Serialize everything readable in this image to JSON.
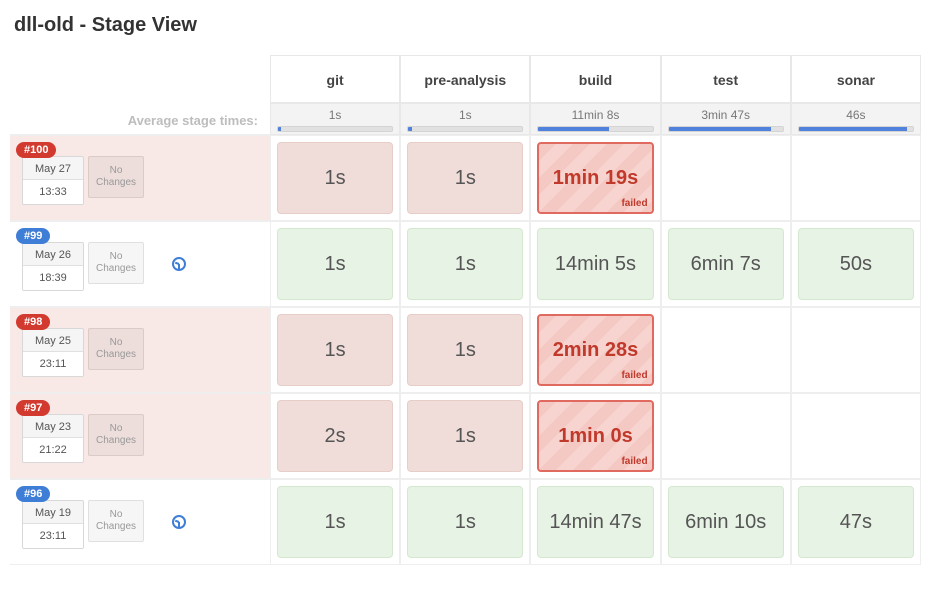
{
  "title": "dll-old - Stage View",
  "avg_label": "Average stage times:",
  "no_changes_text": "No\nChanges",
  "failed_text": "failed",
  "stages": [
    {
      "name": "git",
      "avg": "1s",
      "bar_pct": 3
    },
    {
      "name": "pre-analysis",
      "avg": "1s",
      "bar_pct": 3
    },
    {
      "name": "build",
      "avg": "11min 8s",
      "bar_pct": 62
    },
    {
      "name": "test",
      "avg": "3min 47s",
      "bar_pct": 90
    },
    {
      "name": "sonar",
      "avg": "46s",
      "bar_pct": 95
    }
  ],
  "runs": [
    {
      "id": "#100",
      "date": "May 27",
      "time": "13:33",
      "status": "failed",
      "has_clock": false,
      "cells": [
        {
          "text": "1s",
          "state": "fail-row"
        },
        {
          "text": "1s",
          "state": "fail-row"
        },
        {
          "text": "1min 19s",
          "state": "failed"
        },
        {
          "text": "",
          "state": "empty"
        },
        {
          "text": "",
          "state": "empty"
        }
      ]
    },
    {
      "id": "#99",
      "date": "May 26",
      "time": "18:39",
      "status": "success",
      "has_clock": true,
      "cells": [
        {
          "text": "1s",
          "state": "success"
        },
        {
          "text": "1s",
          "state": "success"
        },
        {
          "text": "14min 5s",
          "state": "success"
        },
        {
          "text": "6min 7s",
          "state": "success"
        },
        {
          "text": "50s",
          "state": "success"
        }
      ]
    },
    {
      "id": "#98",
      "date": "May 25",
      "time": "23:11",
      "status": "failed",
      "has_clock": false,
      "cells": [
        {
          "text": "1s",
          "state": "fail-row"
        },
        {
          "text": "1s",
          "state": "fail-row"
        },
        {
          "text": "2min 28s",
          "state": "failed"
        },
        {
          "text": "",
          "state": "empty"
        },
        {
          "text": "",
          "state": "empty"
        }
      ]
    },
    {
      "id": "#97",
      "date": "May 23",
      "time": "21:22",
      "status": "failed",
      "has_clock": false,
      "cells": [
        {
          "text": "2s",
          "state": "fail-row"
        },
        {
          "text": "1s",
          "state": "fail-row"
        },
        {
          "text": "1min 0s",
          "state": "failed"
        },
        {
          "text": "",
          "state": "empty"
        },
        {
          "text": "",
          "state": "empty"
        }
      ]
    },
    {
      "id": "#96",
      "date": "May 19",
      "time": "23:11",
      "status": "success",
      "has_clock": true,
      "cells": [
        {
          "text": "1s",
          "state": "success"
        },
        {
          "text": "1s",
          "state": "success"
        },
        {
          "text": "14min 47s",
          "state": "success"
        },
        {
          "text": "6min 10s",
          "state": "success"
        },
        {
          "text": "47s",
          "state": "success"
        }
      ]
    }
  ]
}
